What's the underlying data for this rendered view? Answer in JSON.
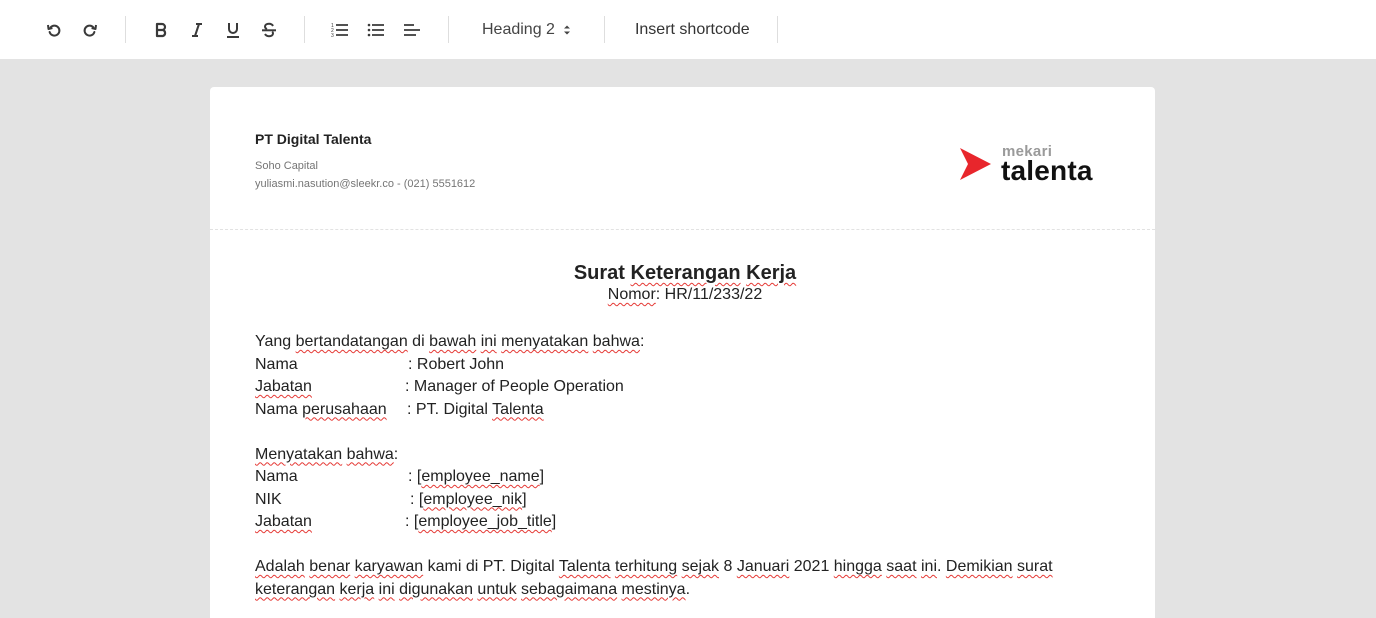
{
  "toolbar": {
    "undo": "undo",
    "redo": "redo",
    "heading_value": "Heading 2",
    "insert_shortcode": "Insert shortcode",
    "icons": [
      "undo-icon",
      "redo-icon",
      "bold-icon",
      "italic-icon",
      "underline-icon",
      "strikethrough-icon",
      "ordered-list-icon",
      "bullet-list-icon",
      "align-left-icon"
    ]
  },
  "letterhead": {
    "company_name": "PT Digital Talenta",
    "address": "Soho Capital",
    "contact": "yuliasmi.nasution@sleekr.co - (021) 5551612",
    "logo_small": "mekari",
    "logo_big": "talenta",
    "logo_color": "#e8262c"
  },
  "doc": {
    "title_words": [
      "Surat",
      "Keterangan",
      "Kerja"
    ],
    "nomor_label": "Nomor",
    "nomor_value": ": HR/11/233/22",
    "intro_1": "Yang ",
    "intro_2": "bertandatangan",
    "intro_3": " di ",
    "intro_4": "bawah",
    "intro_5": " ",
    "intro_6": "ini",
    "intro_7": " ",
    "intro_8": "menyatakan",
    "intro_9": " ",
    "intro_10": "bahwa",
    "intro_11": ":",
    "signer": {
      "nama_label": "Nama",
      "nama_value": ": Robert John",
      "jabatan_label": "Jabatan",
      "jabatan_value": ": Manager of People Operation",
      "perusahaan_label_1": "Nama ",
      "perusahaan_label_2": "perusahaan",
      "perusahaan_value_1": ": PT. Digital ",
      "perusahaan_value_2": "Talenta"
    },
    "menyatakan_1": "Menyatakan",
    "menyatakan_2": " ",
    "menyatakan_3": "bahwa",
    "menyatakan_4": ":",
    "employee": {
      "nama_label": "Nama",
      "nama_prefix": ": [",
      "nama_value": "employee_name",
      "nama_suffix": "]",
      "nik_label": "NIK",
      "nik_prefix": ": [",
      "nik_value": "employee_nik",
      "nik_suffix": "]",
      "jabatan_label": "Jabatan",
      "jabatan_prefix": ": [",
      "jabatan_value": "employee_job_title",
      "jabatan_suffix": "]"
    },
    "closing_line1": [
      [
        "Adalah",
        true
      ],
      [
        " ",
        false
      ],
      [
        "benar",
        true
      ],
      [
        " ",
        false
      ],
      [
        "karyawan",
        true
      ],
      [
        " kami di PT. Digital ",
        false
      ],
      [
        "Talenta",
        true
      ],
      [
        " ",
        false
      ],
      [
        "terhitung",
        true
      ],
      [
        " ",
        false
      ],
      [
        "sejak",
        true
      ],
      [
        " 8 ",
        false
      ],
      [
        "Januari",
        true
      ],
      [
        " 2021 ",
        false
      ],
      [
        "hingga",
        true
      ],
      [
        " ",
        false
      ],
      [
        "saat",
        true
      ],
      [
        " ",
        false
      ],
      [
        "ini",
        true
      ],
      [
        ". ",
        false
      ],
      [
        "Demikian",
        true
      ],
      [
        " ",
        false
      ],
      [
        "surat",
        true
      ]
    ],
    "closing_line2": [
      [
        "keterangan",
        true
      ],
      [
        " ",
        false
      ],
      [
        "kerja",
        true
      ],
      [
        " ",
        false
      ],
      [
        "ini",
        true
      ],
      [
        " ",
        false
      ],
      [
        "digunakan",
        true
      ],
      [
        " ",
        false
      ],
      [
        "untuk",
        true
      ],
      [
        " ",
        false
      ],
      [
        "sebagaimana",
        true
      ],
      [
        " ",
        false
      ],
      [
        "mestinya",
        true
      ],
      [
        ".",
        false
      ]
    ]
  }
}
